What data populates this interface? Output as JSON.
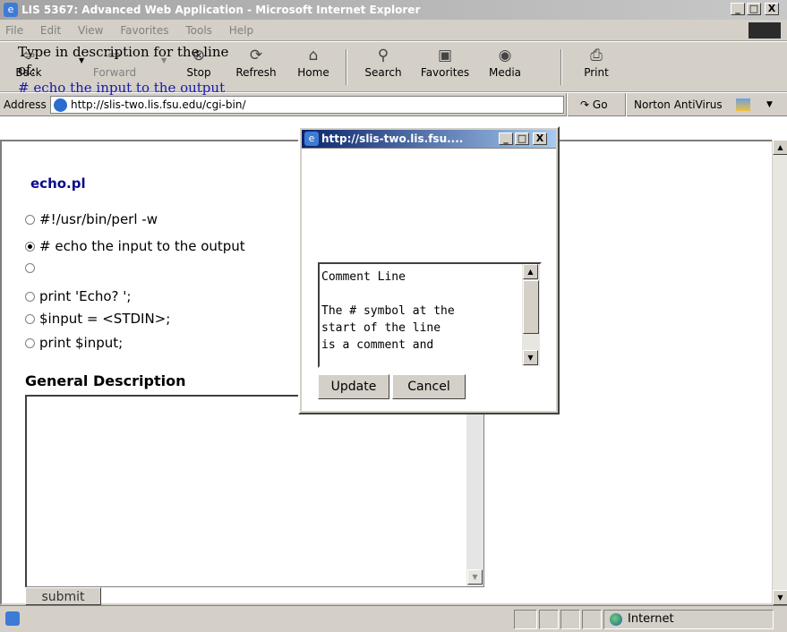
{
  "window": {
    "title": "LIS 5367: Advanced Web Application - Microsoft Internet Explorer",
    "minimize": "_",
    "maximize": "□",
    "close": "X"
  },
  "menu": [
    "File",
    "Edit",
    "View",
    "Favorites",
    "Tools",
    "Help"
  ],
  "toolbar": {
    "back": "Back",
    "forward": "Forward",
    "stop": "Stop",
    "refresh": "Refresh",
    "home": "Home",
    "search": "Search",
    "favorites": "Favorites",
    "media": "Media",
    "print": "Print"
  },
  "address": {
    "label": "Address",
    "url": "http://slis-two.lis.fsu.edu/cgi-bin/",
    "go": "Go",
    "norton": "Norton AntiVirus"
  },
  "page": {
    "title": "echo.pl",
    "lines": [
      {
        "text": "#!/usr/bin/perl -w",
        "selected": false
      },
      {
        "text": "# echo the input to the output",
        "selected": true
      },
      {
        "text": "",
        "selected": false
      },
      {
        "text": "print 'Echo? ';",
        "selected": false
      },
      {
        "text": "$input = <STDIN>;",
        "selected": false
      },
      {
        "text": "print $input;",
        "selected": false
      }
    ],
    "general_heading": "General Description",
    "submit": "submit"
  },
  "popup": {
    "title": "http://slis-two.lis.fsu....",
    "prompt": "Type in description for the line of:",
    "line": "# echo the input to the output",
    "textarea_text": "Comment Line\n\nThe # symbol at the\nstart of the line\nis a comment and",
    "update": "Update",
    "cancel": "Cancel"
  },
  "status": {
    "zone": "Internet"
  }
}
